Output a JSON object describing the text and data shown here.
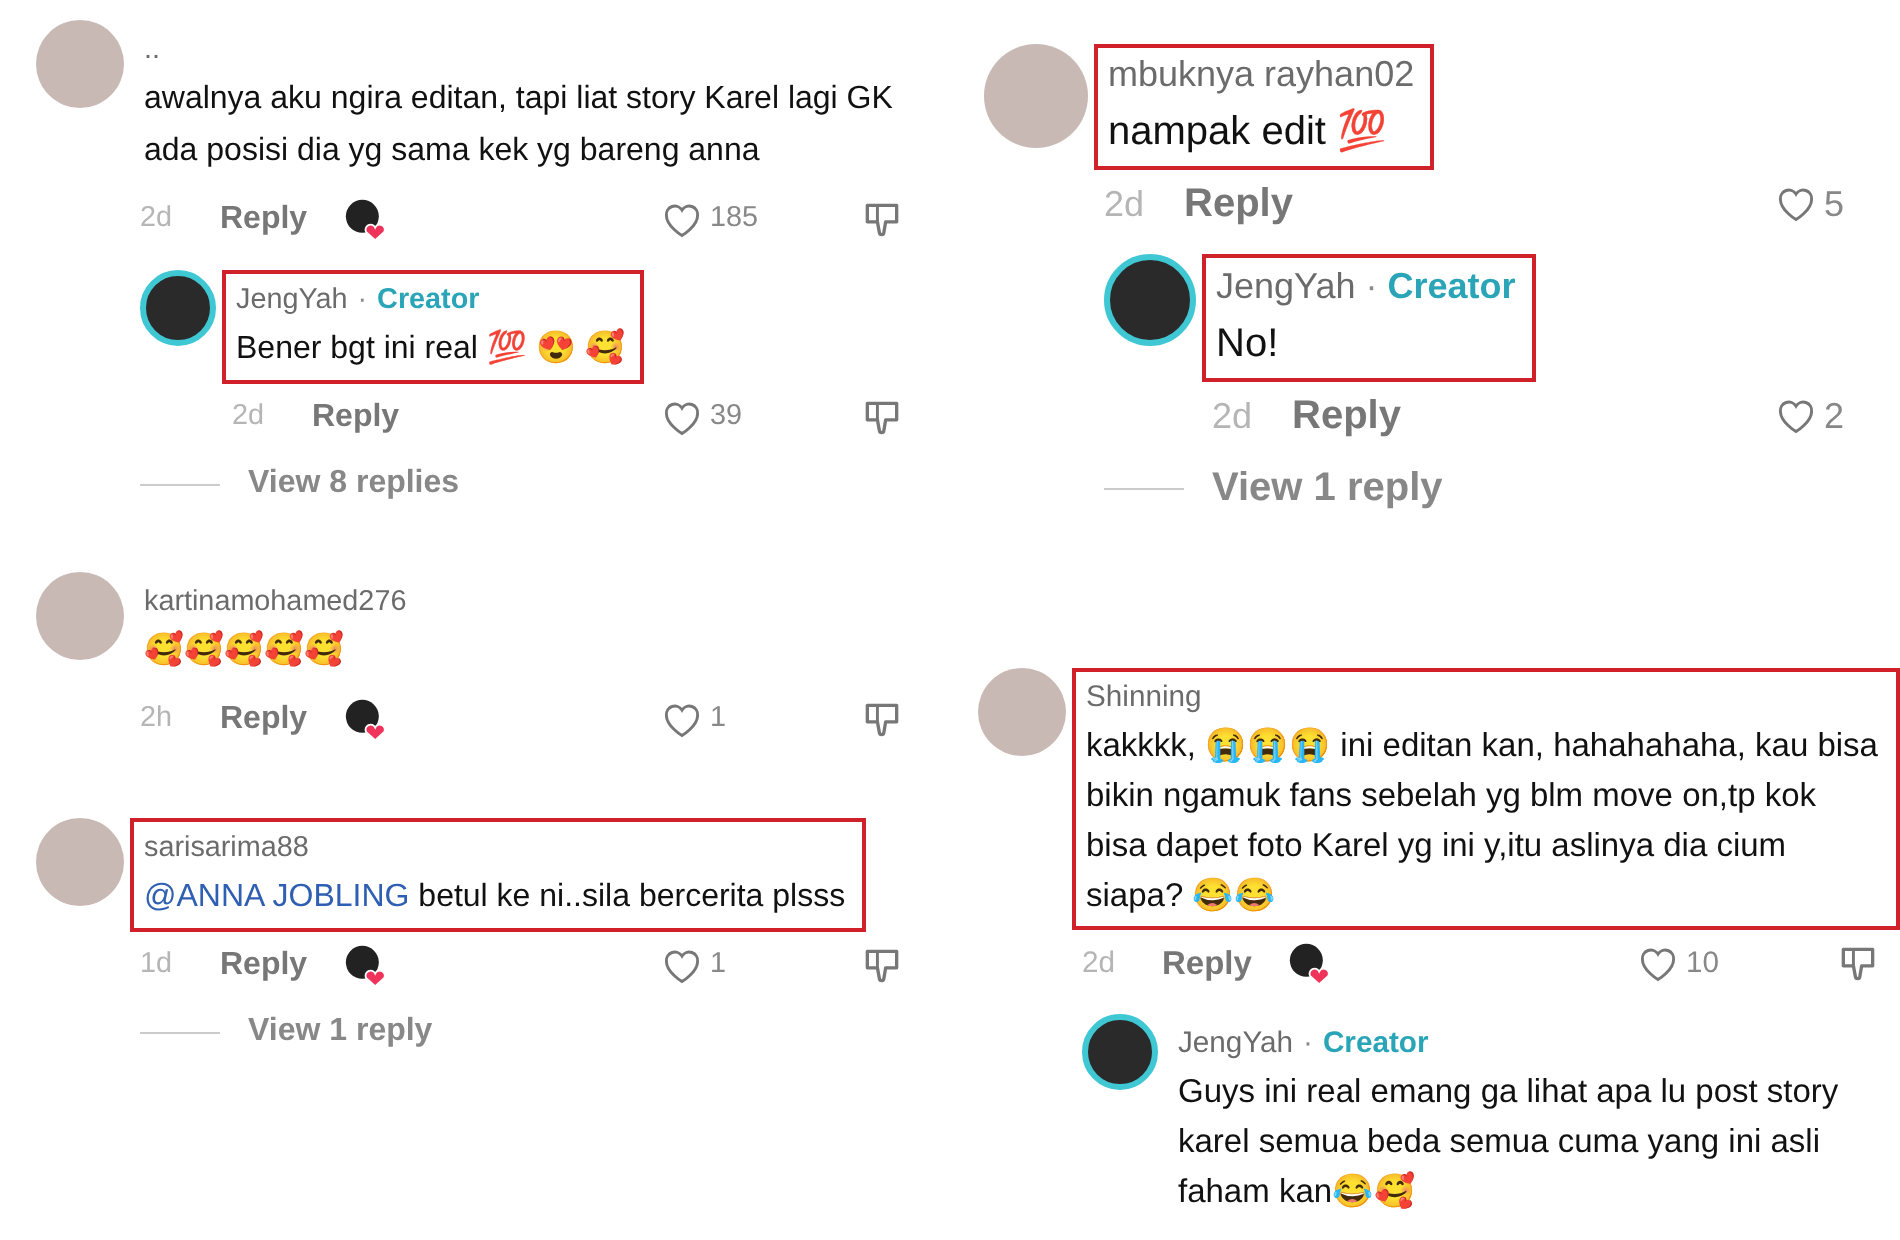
{
  "panels": [
    {
      "comments": [
        {
          "author": "..",
          "text": "awalnya aku ngira editan, tapi liat story Karel lagi GK ada posisi dia yg sama kek yg bareng anna",
          "time": "2d",
          "reply": "Reply",
          "liked_by_creator": true,
          "likes": "185",
          "dislike_icon": true,
          "highlighted": false,
          "replies": [
            {
              "author": "JengYah",
              "separator": "·",
              "badge": "Creator",
              "text": "Bener bgt ini real 💯 😍 🥰",
              "time": "2d",
              "reply": "Reply",
              "liked_by_creator": false,
              "likes": "39",
              "dislike_icon": true,
              "highlighted": true
            }
          ],
          "view_replies": "View 8 replies"
        },
        {
          "author": "kartinamohamed276",
          "text": "🥰🥰🥰🥰🥰",
          "time": "2h",
          "reply": "Reply",
          "liked_by_creator": true,
          "likes": "1",
          "dislike_icon": true,
          "highlighted": false
        },
        {
          "author": "sarisarima88",
          "mention": "@ANNA JOBLING",
          "text": "betul ke ni..sila bercerita plsss",
          "time": "1d",
          "reply": "Reply",
          "liked_by_creator": true,
          "likes": "1",
          "dislike_icon": true,
          "highlighted": true,
          "view_replies": "View 1 reply"
        }
      ]
    },
    {
      "comments": [
        {
          "author": "mbuknya rayhan02",
          "text": "nampak edit 💯",
          "time": "2d",
          "reply": "Reply",
          "liked_by_creator": false,
          "likes": "5",
          "dislike_icon": false,
          "highlighted": true,
          "replies": [
            {
              "author": "JengYah",
              "separator": "·",
              "badge": "Creator",
              "text": "No!",
              "time": "2d",
              "reply": "Reply",
              "liked_by_creator": false,
              "likes": "2",
              "dislike_icon": false,
              "highlighted": true
            }
          ],
          "view_replies": "View 1 reply"
        }
      ]
    },
    {
      "comments": [
        {
          "author": "Shinning",
          "text": "kakkkk, 😭😭😭 ini editan kan, hahahahaha, kau bisa bikin ngamuk fans sebelah yg blm move on,tp kok bisa dapet foto Karel yg ini y,itu aslinya dia cium siapa? 😂😂",
          "time": "2d",
          "reply": "Reply",
          "liked_by_creator": true,
          "likes": "10",
          "dislike_icon": true,
          "highlighted": true,
          "replies": [
            {
              "author": "JengYah",
              "separator": "·",
              "badge": "Creator",
              "text": "Guys ini real emang ga lihat apa lu post story karel semua beda semua cuma yang ini asli faham kan😂🥰"
            }
          ]
        }
      ]
    }
  ]
}
